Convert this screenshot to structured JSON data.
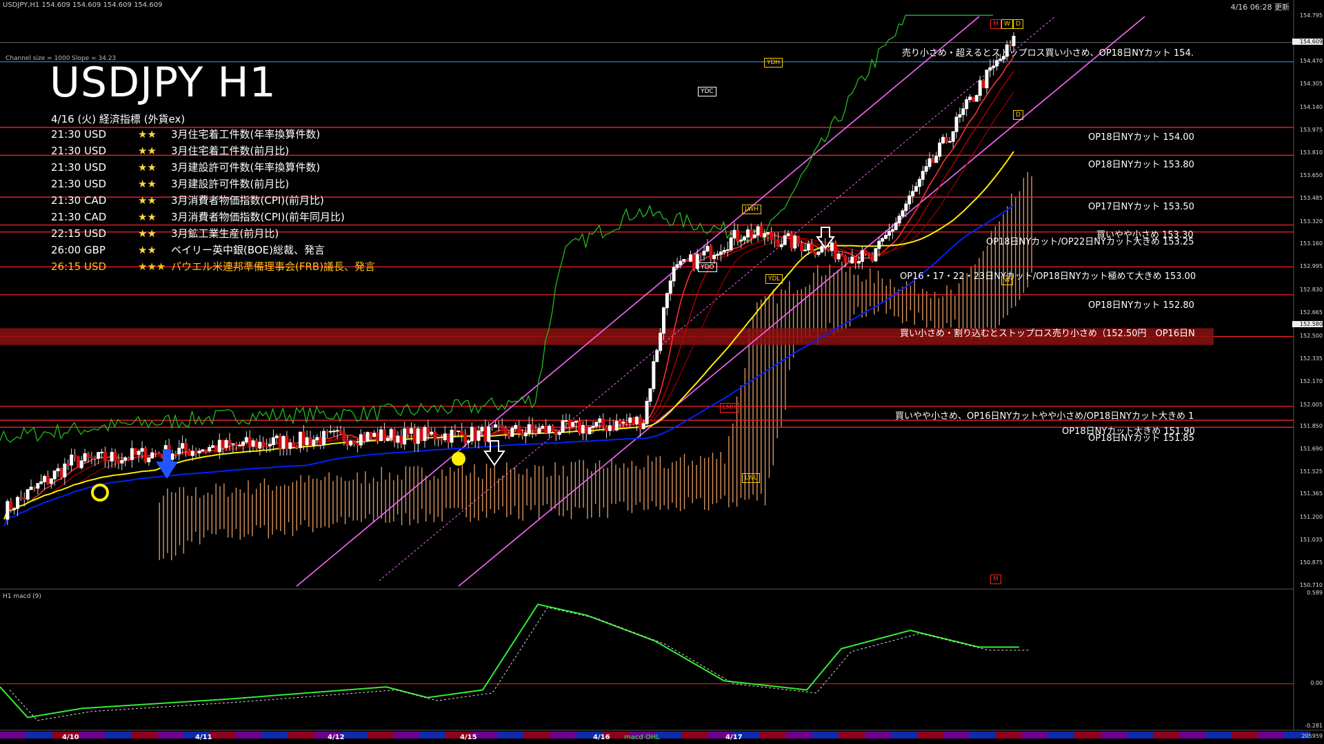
{
  "window": {
    "symbol_line": "USDJPY,H1   154.609 154.609 154.609 154.609",
    "timestamp": "4/16 06:28 更新"
  },
  "overlay": {
    "channel_info": "Channel size = 1000 Slope = 34.23",
    "title": "USDJPY H1",
    "events_title": "4/16 (火) 経済指標 (外貨ex)",
    "events": [
      {
        "time": "21:30 USD",
        "stars": "★★",
        "name": "3月住宅着工件数(年率換算件数)",
        "highlight": false
      },
      {
        "time": "21:30 USD",
        "stars": "★★",
        "name": "3月住宅着工件数(前月比)",
        "highlight": false
      },
      {
        "time": "21:30 USD",
        "stars": "★★",
        "name": "3月建設許可件数(年率換算件数)",
        "highlight": false
      },
      {
        "time": "21:30 USD",
        "stars": "★★",
        "name": "3月建設許可件数(前月比)",
        "highlight": false
      },
      {
        "time": "21:30 CAD",
        "stars": "★★",
        "name": "3月消費者物価指数(CPI)(前月比)",
        "highlight": false
      },
      {
        "time": "21:30 CAD",
        "stars": "★★",
        "name": "3月消費者物価指数(CPI)(前年同月比)",
        "highlight": false
      },
      {
        "time": "22:15 USD",
        "stars": "★★",
        "name": "3月鉱工業生産(前月比)",
        "highlight": false
      },
      {
        "time": "26:00 GBP",
        "stars": "★★",
        "name": "ベイリー英中銀(BOE)総裁、発言",
        "highlight": false
      },
      {
        "time": "26:15 USD",
        "stars": "★★★",
        "name": "パウエル米連邦準備理事会(FRB)議長、発言",
        "highlight": true
      }
    ]
  },
  "annotations": {
    "resistance_note": "売り小さめ・超えるとストップロス買い小さめ、OP18日NYカット 154.",
    "op18_154": "OP18日NYカット 154.00",
    "op18_1538": "OP18日NYカット 153.80",
    "op17_1535": "OP17日NYカット 153.50",
    "buy_15330": "買いやや小さめ 153.30",
    "op18_15325": "OP18日NYカット/OP22日NYカット大きめ 153.25",
    "op16_153": "OP16・17・22・23日NYカット/OP18日NYカット極めて大きめ 153.00",
    "op18_1528": "OP18日NYカット 152.80",
    "buy_1525": "買い小さめ・割り込むとストップロス売り小さめ（152.50円　OP16日N",
    "buy_152": "買いやや小さめ、OP16日NYカットやや小さめ/OP18日NYカット大きめ 1",
    "op18_1519": "OP18日NYカット大きめ 151.90",
    "op18_15185": "OP18日NYカット 151.85"
  },
  "tags": {
    "ydh": "YDH",
    "ydc": "YDC",
    "ydo": "YDO",
    "ydl": "YDL",
    "lwh": "LWH",
    "lwl": "LWL",
    "lmh": "LMH",
    "m": "M",
    "w": "W",
    "d": "D",
    "d2": "D",
    "w2": "W",
    "m2": "M"
  },
  "colors": {
    "resistance": "#ff2020",
    "channel": "#ff66ff",
    "ma_yellow": "#ffee00",
    "ma_blue": "#0022ff",
    "cloud": "#ffb070",
    "green": "#22bb22",
    "macd": "#33ee33"
  },
  "price_axis": {
    "labels": [
      "154.795",
      "154.609",
      "154.470",
      "154.305",
      "154.140",
      "153.975",
      "153.810",
      "153.650",
      "153.485",
      "153.320",
      "153.160",
      "152.995",
      "152.830",
      "152.665",
      "152.580",
      "152.500",
      "152.335",
      "152.170",
      "152.005",
      "151.850",
      "151.690",
      "151.525",
      "151.365",
      "151.200",
      "151.035",
      "150.875",
      "150.710"
    ],
    "current": "154.609",
    "marker": "152.580"
  },
  "macd_axis": {
    "label": "H1  macd (9)",
    "labels": [
      "0.589",
      "0.00",
      "-0.281"
    ],
    "bottom": "205959"
  },
  "date_axis": {
    "labels": [
      "4/10",
      "4/11",
      "4/12",
      "4/15",
      "4/16",
      "4/17"
    ],
    "misc": "macd OHL"
  },
  "chart_data": {
    "type": "line",
    "title": "USDJPY H1",
    "xlabel": "",
    "ylabel": "",
    "ylim": [
      150.71,
      154.795
    ],
    "grid": false,
    "x": [
      "4/10",
      "4/10",
      "4/11",
      "4/11",
      "4/12",
      "4/12",
      "4/15",
      "4/15",
      "4/15",
      "4/16",
      "4/16",
      "4/16",
      "4/16"
    ],
    "series": [
      {
        "name": "USDJPY",
        "values": [
          151.25,
          151.6,
          151.7,
          151.78,
          151.8,
          151.85,
          151.9,
          152.95,
          153.25,
          153.05,
          153.6,
          154.3,
          154.609
        ]
      }
    ],
    "horizontal_levels": [
      154.0,
      153.8,
      153.5,
      153.3,
      153.25,
      153.0,
      152.8,
      152.5,
      152.0,
      151.9,
      151.85
    ]
  }
}
